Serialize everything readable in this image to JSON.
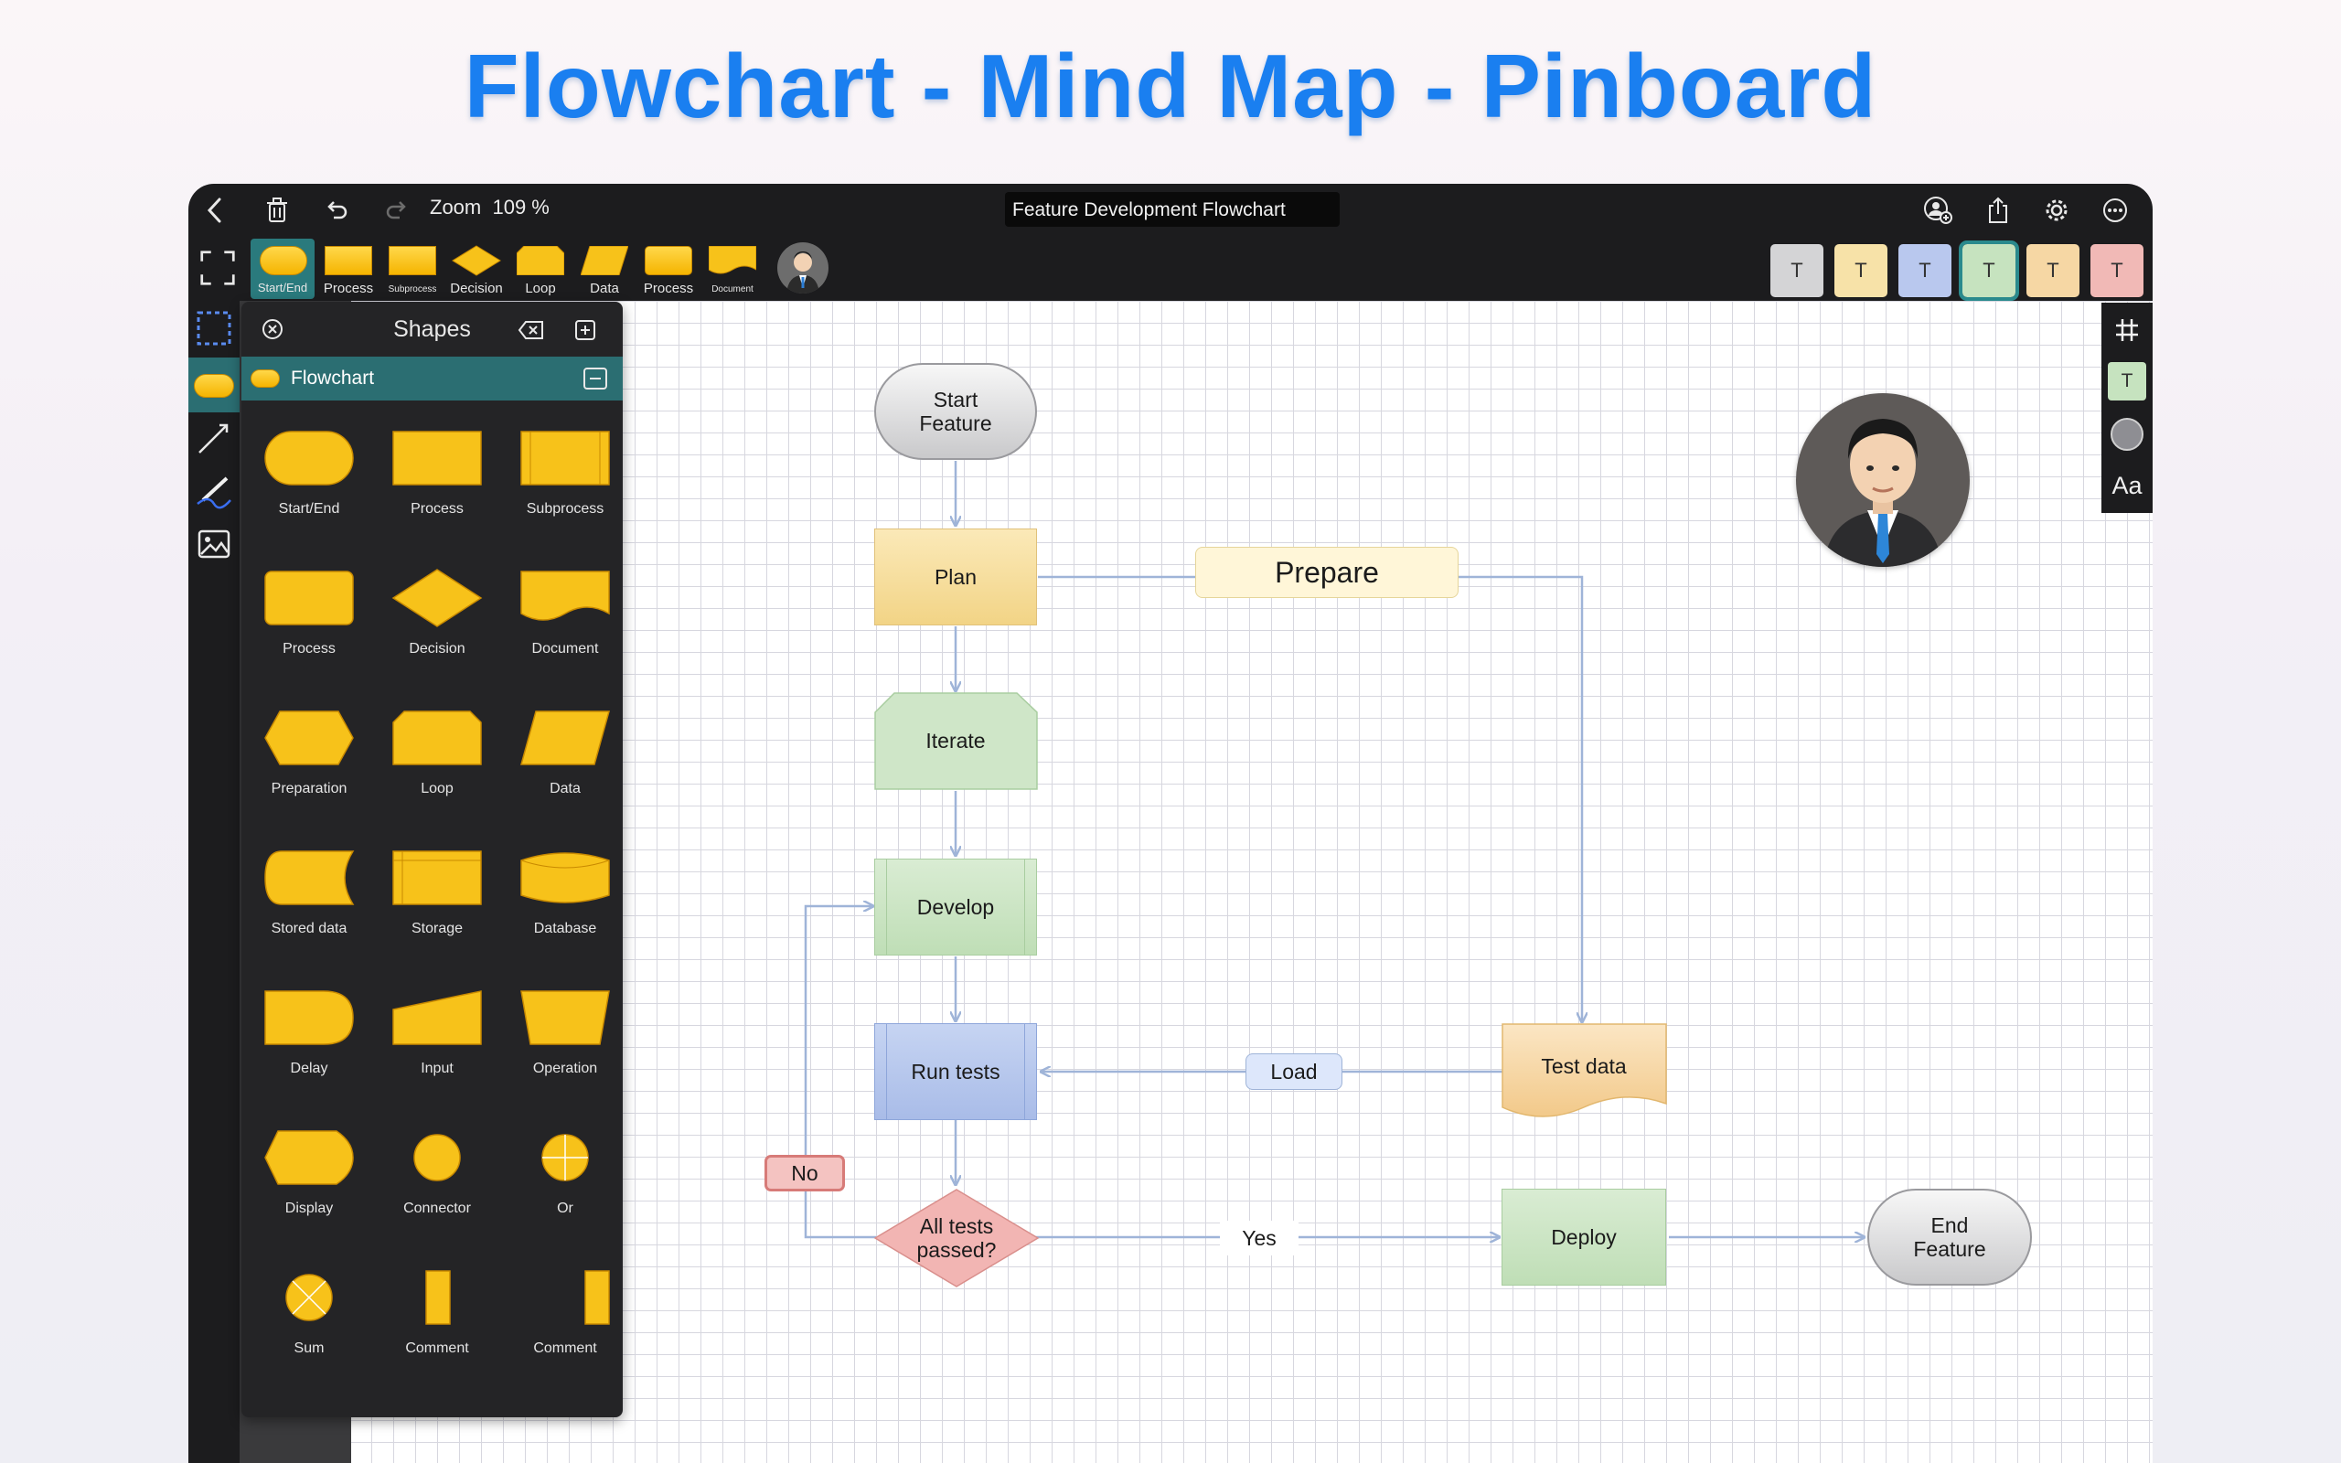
{
  "banner": {
    "title": "Flowchart - Mind Map - Pinboard"
  },
  "topbar": {
    "zoom_label": "Zoom",
    "zoom_value": "109 %",
    "document_title": "Feature Development Flowchart"
  },
  "quick_shapes": [
    {
      "label": "Start/End",
      "active": true
    },
    {
      "label": "Process"
    },
    {
      "label": "Subprocess"
    },
    {
      "label": "Decision"
    },
    {
      "label": "Loop"
    },
    {
      "label": "Data"
    },
    {
      "label": "Process"
    },
    {
      "label": "Document"
    }
  ],
  "text_swatches": [
    {
      "label": "T",
      "color": "#d4d4d6"
    },
    {
      "label": "T",
      "color": "#f7e2a8"
    },
    {
      "label": "T",
      "color": "#b9c8ee"
    },
    {
      "label": "T",
      "color": "#c6e3bf"
    },
    {
      "label": "T",
      "color": "#f6d7a4"
    },
    {
      "label": "T",
      "color": "#f1b9b6"
    }
  ],
  "shapes_panel": {
    "title": "Shapes",
    "category": "Flowchart",
    "items": [
      {
        "label": "Start/End",
        "icon": "terminator-shape"
      },
      {
        "label": "Process",
        "icon": "rectangle-shape"
      },
      {
        "label": "Subprocess",
        "icon": "subprocess-shape"
      },
      {
        "label": "Process",
        "icon": "rounded-rect-shape"
      },
      {
        "label": "Decision",
        "icon": "diamond-shape"
      },
      {
        "label": "Document",
        "icon": "document-shape"
      },
      {
        "label": "Preparation",
        "icon": "hexagon-shape"
      },
      {
        "label": "Loop",
        "icon": "loop-shape"
      },
      {
        "label": "Data",
        "icon": "parallelogram-shape"
      },
      {
        "label": "Stored data",
        "icon": "stored-data-shape"
      },
      {
        "label": "Storage",
        "icon": "storage-shape"
      },
      {
        "label": "Database",
        "icon": "cylinder-shape"
      },
      {
        "label": "Delay",
        "icon": "delay-shape"
      },
      {
        "label": "Input",
        "icon": "manual-input-shape"
      },
      {
        "label": "Operation",
        "icon": "trapezoid-shape"
      },
      {
        "label": "Display",
        "icon": "display-shape"
      },
      {
        "label": "Connector",
        "icon": "circle-shape"
      },
      {
        "label": "Or",
        "icon": "or-shape"
      },
      {
        "label": "Sum",
        "icon": "sum-shape"
      },
      {
        "label": "Comment",
        "icon": "comment-left-shape"
      },
      {
        "label": "Comment",
        "icon": "comment-right-shape"
      }
    ]
  },
  "right_tools": {
    "font_label": "Aa",
    "text_label": "T"
  },
  "diagram": {
    "nodes": {
      "start": "Start\nFeature",
      "plan": "Plan",
      "prepare": "Prepare",
      "iterate": "Iterate",
      "develop": "Develop",
      "run_tests": "Run tests",
      "load": "Load",
      "test_data": "Test data",
      "no": "No",
      "decision": "All tests\npassed?",
      "yes": "Yes",
      "deploy": "Deploy",
      "end": "End\nFeature"
    }
  },
  "colors": {
    "accent": "#1a7ff0",
    "teal": "#2b6e72",
    "connector": "#9fb4d8",
    "shape_fill": "#f5b400"
  }
}
